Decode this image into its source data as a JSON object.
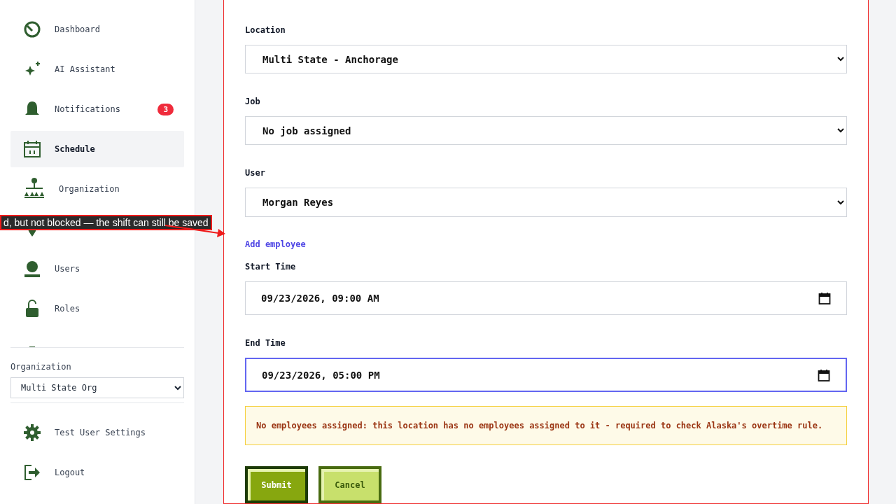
{
  "sidebar": {
    "items": [
      {
        "label": "Dashboard",
        "selected": false
      },
      {
        "label": "AI Assistant",
        "selected": false
      },
      {
        "label": "Notifications",
        "selected": false,
        "badge": "3"
      },
      {
        "label": "Schedule",
        "selected": true
      },
      {
        "label": "Organization",
        "selected": false
      },
      {
        "selected": false
      },
      {
        "label": "Users",
        "selected": false
      },
      {
        "label": "Roles",
        "selected": false
      }
    ],
    "organization": {
      "label": "Organization",
      "value": "Multi State Org"
    },
    "footer_items": [
      {
        "label": "Test User Settings"
      },
      {
        "label": "Logout"
      }
    ]
  },
  "callout": {
    "text": "d, but not blocked — the shift can still be saved"
  },
  "form": {
    "selects": [
      {
        "label": "Location",
        "value": "Multi State - Anchorage"
      },
      {
        "label": "Job",
        "value": "No job assigned"
      },
      {
        "label": "User",
        "value": "Morgan Reyes"
      }
    ],
    "add_link": "Add employee",
    "times": [
      {
        "label": "Start Time",
        "value": "09/23/2026, 09:00 AM",
        "focused": false
      },
      {
        "label": "End Time",
        "value": "09/23/2026, 05:00 PM",
        "focused": true
      }
    ],
    "alert": "No employees assigned: this location has no employees assigned to it - required to check Alaska's overtime rule.",
    "buttons": [
      {
        "label": "Submit",
        "kind": "primary"
      },
      {
        "label": "Cancel",
        "kind": "secondary"
      }
    ]
  }
}
